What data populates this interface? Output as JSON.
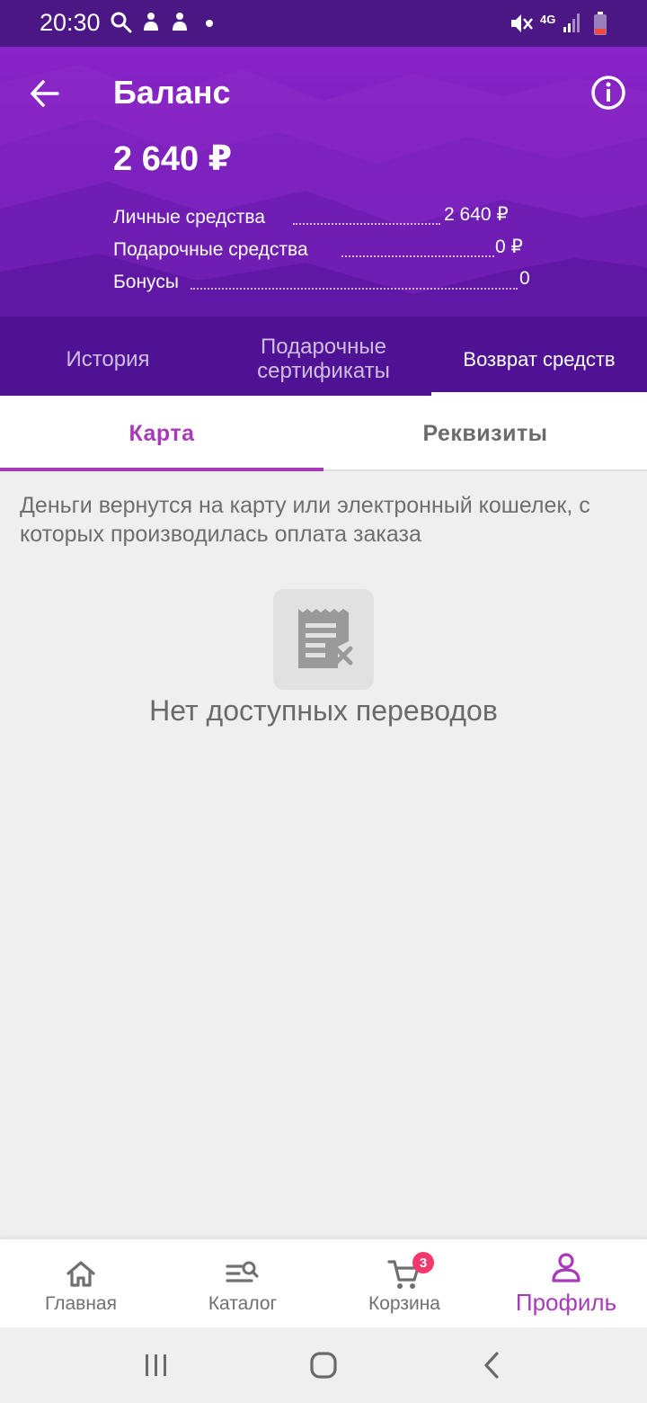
{
  "status_bar": {
    "time": "20:30",
    "network": "4G"
  },
  "header": {
    "title": "Баланс",
    "amount": "2 640 ₽",
    "breakdown": [
      {
        "label": "Личные средства",
        "value": "2 640 ₽"
      },
      {
        "label": "Подарочные средства",
        "value": "0 ₽"
      },
      {
        "label": "Бонусы",
        "value": "0"
      }
    ]
  },
  "top_tabs": [
    {
      "label": "История",
      "active": false
    },
    {
      "label": "Подарочные сертификаты",
      "active": false
    },
    {
      "label": "Возврат средств",
      "active": true
    }
  ],
  "sub_tabs": [
    {
      "label": "Карта",
      "active": true
    },
    {
      "label": "Реквизиты",
      "active": false
    }
  ],
  "content": {
    "description": "Деньги вернутся на карту или электронный кошелек, с которых производилась оплата заказа",
    "empty_icon": "receipt-cancel-icon",
    "empty_text": "Нет доступных переводов"
  },
  "bottom_nav": [
    {
      "label": "Главная",
      "icon": "home-icon",
      "active": false
    },
    {
      "label": "Каталог",
      "icon": "catalog-search-icon",
      "active": false
    },
    {
      "label": "Корзина",
      "icon": "cart-icon",
      "active": false,
      "badge": "3"
    },
    {
      "label": "Профиль",
      "icon": "profile-icon",
      "active": true
    }
  ],
  "colors": {
    "accent": "#a73ab8",
    "header_top": "#8a23c9",
    "header_bottom": "#4c1290",
    "badge": "#f2386d",
    "background": "#efefef"
  }
}
